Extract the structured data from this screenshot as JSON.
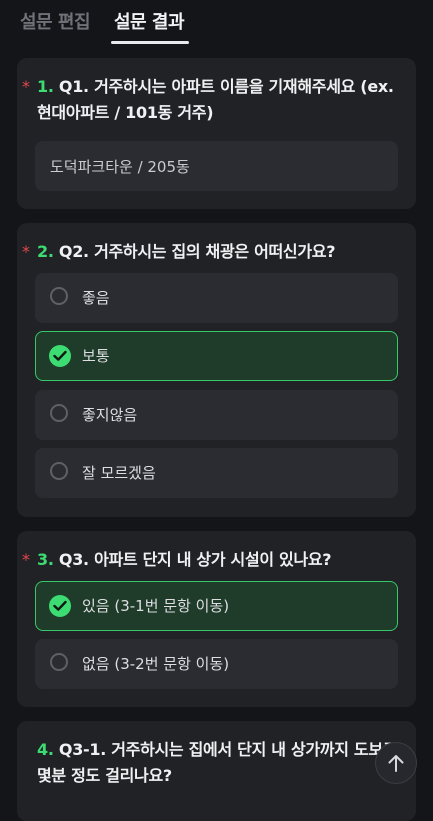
{
  "tabs": {
    "edit": "설문 편집",
    "result": "설문 결과"
  },
  "questions": [
    {
      "num": "1.",
      "title": " Q1. 거주하시는 아파트 이름을 기재해주세요 (ex. 현대아파트 / 101동 거주)",
      "required": "*",
      "answer": "도덕파크타운 / 205동"
    },
    {
      "num": "2.",
      "title": " Q2. 거주하시는 집의 채광은 어떠신가요?",
      "required": "*",
      "options": [
        "좋음",
        "보통",
        "좋지않음",
        "잘 모르겠음"
      ],
      "selected": "보통"
    },
    {
      "num": "3.",
      "title": " Q3. 아파트 단지 내 상가 시설이 있나요?",
      "required": "*",
      "options": [
        "있음 (3-1번 문항 이동)",
        "없음 (3-2번 문항 이동)"
      ],
      "selected": "있음 (3-1번 문항 이동)"
    },
    {
      "num": "4.",
      "title": " Q3-1. 거주하시는 집에서 단지 내 상가까지 도보로 몇분 정도 걸리나요?"
    }
  ],
  "icons": {
    "check": "check-icon",
    "scroll_top": "arrow-up-icon"
  },
  "colors": {
    "accent": "#3ddc72",
    "required": "#e5484d",
    "background": "#141518",
    "card": "#202226"
  }
}
